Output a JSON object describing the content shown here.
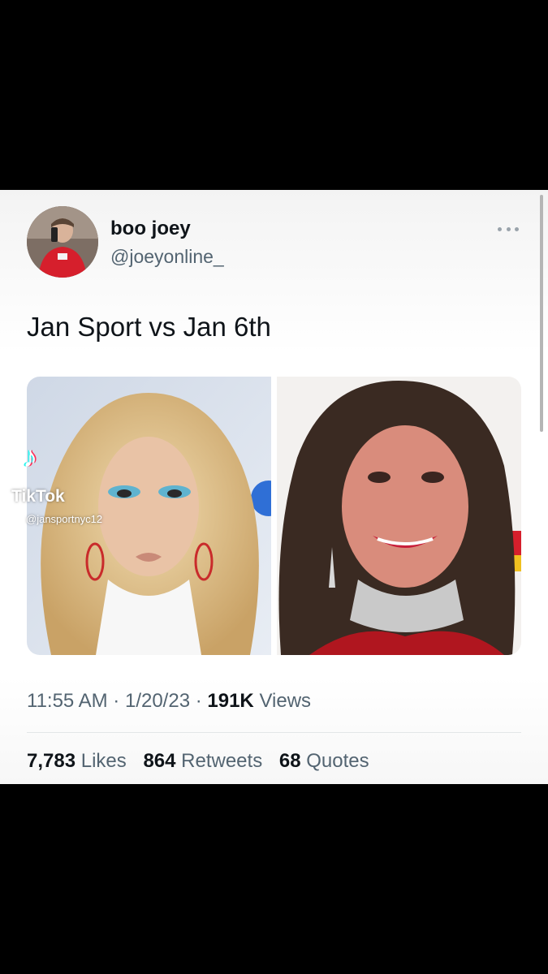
{
  "tweet": {
    "author": {
      "name": "boo joey",
      "handle": "@joeyonline_"
    },
    "text": "Jan Sport vs Jan 6th",
    "media": {
      "left_image": "drag-queen-portrait-blonde",
      "right_image": "woman-portrait-dark-hair",
      "watermark": {
        "brand": "TikTok",
        "logo_glyph": "♪",
        "username": "@jansportnyc12"
      }
    },
    "meta": {
      "time": "11:55 AM",
      "separator": "·",
      "date": "1/20/23",
      "views_count": "191K",
      "views_label": "Views"
    },
    "stats": {
      "likes_count": "7,783",
      "likes_label": "Likes",
      "retweets_count": "864",
      "retweets_label": "Retweets",
      "quotes_count": "68",
      "quotes_label": "Quotes"
    },
    "colors": {
      "text_primary": "#0f1419",
      "text_secondary": "#536471",
      "divider": "#e3e6e8"
    },
    "icons": {
      "more": "more-horizontal-icon"
    }
  }
}
